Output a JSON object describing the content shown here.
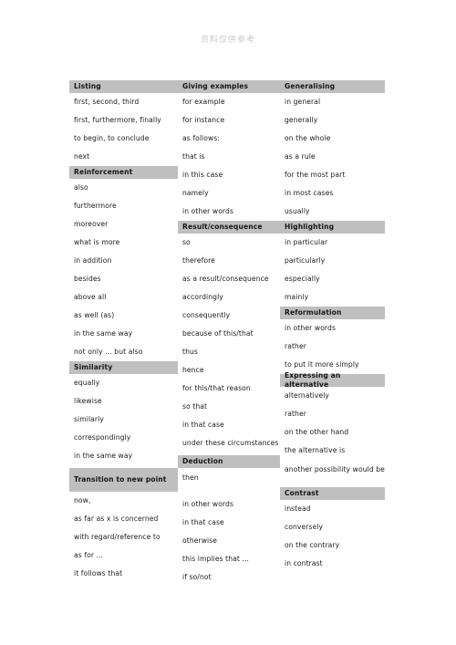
{
  "watermark": {
    "text": "资料仅供参考"
  },
  "table": {
    "columns": [
      {
        "name": "column-listing",
        "rows": [
          {
            "type": "header",
            "text": "Listing"
          },
          {
            "type": "item",
            "text": "first, second, third"
          },
          {
            "type": "item",
            "text": "first, furthermore, finally"
          },
          {
            "type": "item",
            "text": "to begin, to conclude"
          },
          {
            "type": "item",
            "text": "next"
          },
          {
            "type": "header",
            "text": "Reinforcement"
          },
          {
            "type": "item",
            "text": "also"
          },
          {
            "type": "item",
            "text": "furthermore"
          },
          {
            "type": "item",
            "text": "moreover"
          },
          {
            "type": "item",
            "text": "what is more"
          },
          {
            "type": "item",
            "text": "in addition"
          },
          {
            "type": "item",
            "text": "besides"
          },
          {
            "type": "item",
            "text": "above all"
          },
          {
            "type": "item",
            "text": "as well (as)"
          },
          {
            "type": "item",
            "text": "in the same way"
          },
          {
            "type": "item",
            "text": "not only ... but also"
          },
          {
            "type": "header",
            "text": "Similarity"
          },
          {
            "type": "item",
            "text": "equally"
          },
          {
            "type": "item",
            "text": "likewise"
          },
          {
            "type": "item",
            "text": "similarly"
          },
          {
            "type": "item",
            "text": "correspondingly"
          },
          {
            "type": "item",
            "text": "in the same way"
          },
          {
            "type": "header-tall",
            "text": "Transition to new point"
          },
          {
            "type": "item",
            "text": "now,"
          },
          {
            "type": "item",
            "text": "as far as x is concerned"
          },
          {
            "type": "item",
            "text": "with regard/reference to"
          },
          {
            "type": "item",
            "text": "as for ..."
          },
          {
            "type": "item",
            "text": "it follows that"
          }
        ]
      },
      {
        "name": "column-giving-examples",
        "rows": [
          {
            "type": "header",
            "text": "Giving examples"
          },
          {
            "type": "item",
            "text": "for example"
          },
          {
            "type": "item",
            "text": "for instance"
          },
          {
            "type": "item",
            "text": "as follows:"
          },
          {
            "type": "item",
            "text": "that is"
          },
          {
            "type": "item",
            "text": "in this case"
          },
          {
            "type": "item",
            "text": "namely"
          },
          {
            "type": "item",
            "text": "in other words"
          },
          {
            "type": "header",
            "text": "Result/consequence"
          },
          {
            "type": "item",
            "text": "so"
          },
          {
            "type": "item",
            "text": "therefore"
          },
          {
            "type": "item",
            "text": "as a result/consequence"
          },
          {
            "type": "item",
            "text": "accordingly"
          },
          {
            "type": "item",
            "text": "consequently"
          },
          {
            "type": "item",
            "text": "because of this/that"
          },
          {
            "type": "item",
            "text": "thus"
          },
          {
            "type": "item",
            "text": "hence"
          },
          {
            "type": "item",
            "text": "for this/that reason"
          },
          {
            "type": "item",
            "text": "so that"
          },
          {
            "type": "item",
            "text": "in that case"
          },
          {
            "type": "item",
            "text": "under these circumstances"
          },
          {
            "type": "header",
            "text": "Deduction"
          },
          {
            "type": "item",
            "text": "then"
          },
          {
            "type": "item",
            "text": "in other words"
          },
          {
            "type": "item",
            "text": "in that case"
          },
          {
            "type": "item",
            "text": "otherwise"
          },
          {
            "type": "item",
            "text": "this implies that ..."
          },
          {
            "type": "item",
            "text": "if so/not"
          }
        ]
      },
      {
        "name": "column-generalising",
        "rows": [
          {
            "type": "header",
            "text": "Generalising"
          },
          {
            "type": "item",
            "text": "in general"
          },
          {
            "type": "item",
            "text": "generally"
          },
          {
            "type": "item",
            "text": "on the whole"
          },
          {
            "type": "item",
            "text": "as a rule"
          },
          {
            "type": "item",
            "text": "for the most part"
          },
          {
            "type": "item",
            "text": "in most cases"
          },
          {
            "type": "item",
            "text": "usually"
          },
          {
            "type": "header",
            "text": "Highlighting"
          },
          {
            "type": "item",
            "text": "in particular"
          },
          {
            "type": "item",
            "text": "particularly"
          },
          {
            "type": "item",
            "text": "especially"
          },
          {
            "type": "item",
            "text": "mainly"
          },
          {
            "type": "header",
            "text": "Reformulation"
          },
          {
            "type": "item",
            "text": "in other words"
          },
          {
            "type": "item",
            "text": "rather"
          },
          {
            "type": "item",
            "text": "to put it more simply"
          },
          {
            "type": "header",
            "text": "Expressing an alternative"
          },
          {
            "type": "item",
            "text": "alternatively"
          },
          {
            "type": "item",
            "text": "rather"
          },
          {
            "type": "item",
            "text": "on the other hand"
          },
          {
            "type": "item",
            "text": "the alternative is"
          },
          {
            "type": "item-tall",
            "text": "another possibility would be"
          },
          {
            "type": "header",
            "text": "Contrast"
          },
          {
            "type": "item",
            "text": "instead"
          },
          {
            "type": "item",
            "text": "conversely"
          },
          {
            "type": "item",
            "text": "on the contrary"
          },
          {
            "type": "item",
            "text": "in contrast"
          }
        ]
      }
    ]
  },
  "colors": {
    "header_bg": "#bfbfbf",
    "text": "#1b1b1b",
    "watermark": "#c9c9c9",
    "page_bg": "#ffffff"
  }
}
